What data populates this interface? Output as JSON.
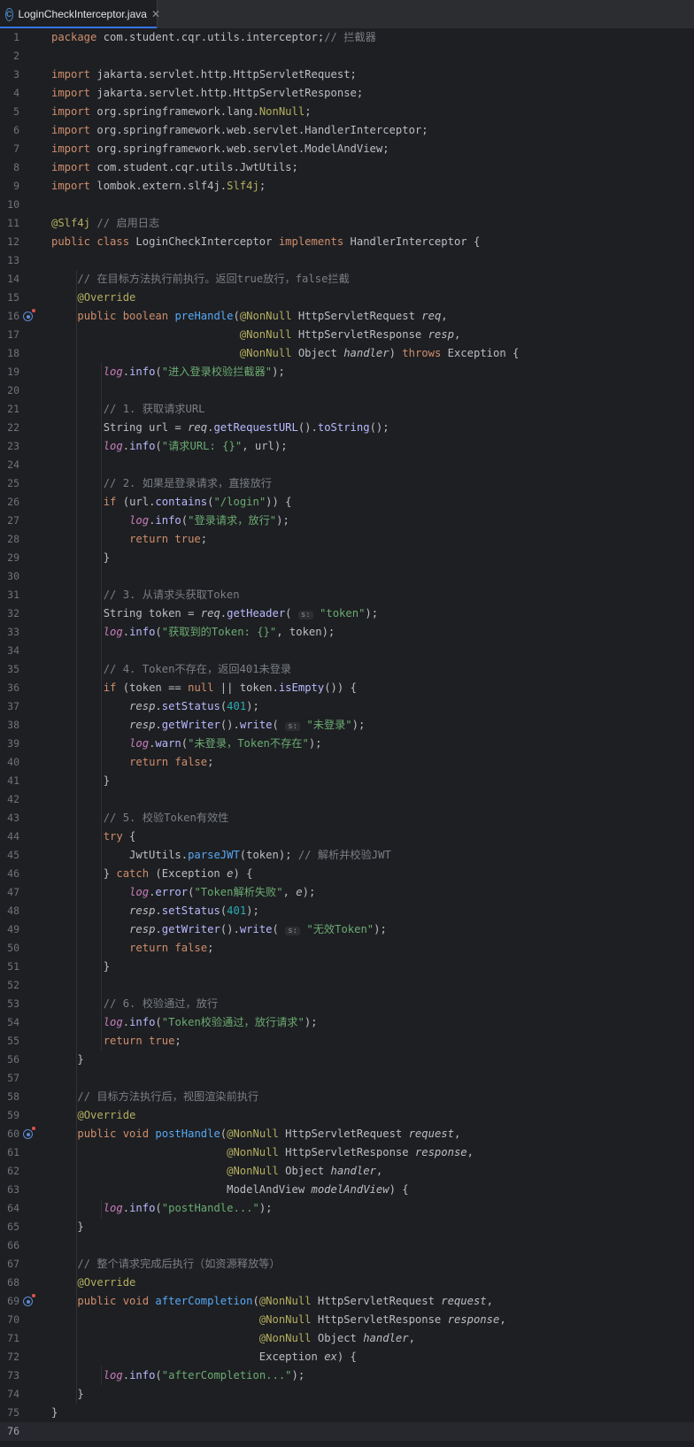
{
  "tab": {
    "filename": "LoginCheckInterceptor.java",
    "icon": "java-class-icon",
    "close_glyph": "✕"
  },
  "editor": {
    "current_line": 76,
    "gutter_icons": [
      {
        "line": 16,
        "icon": "override-method-icon"
      },
      {
        "line": 60,
        "icon": "override-method-icon"
      },
      {
        "line": 69,
        "icon": "override-method-icon"
      }
    ],
    "lines": [
      [
        [
          "kw",
          "package"
        ],
        [
          "t",
          " com.student.cqr.utils.interceptor;"
        ],
        [
          "cmt",
          "// 拦截器"
        ]
      ],
      [],
      [
        [
          "kw",
          "import"
        ],
        [
          "t",
          " jakarta.servlet.http.HttpServletRequest;"
        ]
      ],
      [
        [
          "kw",
          "import"
        ],
        [
          "t",
          " jakarta.servlet.http.HttpServletResponse;"
        ]
      ],
      [
        [
          "kw",
          "import"
        ],
        [
          "t",
          " org.springframework.lang."
        ],
        [
          "ann",
          "NonNull"
        ],
        [
          "t",
          ";"
        ]
      ],
      [
        [
          "kw",
          "import"
        ],
        [
          "t",
          " org.springframework.web.servlet.HandlerInterceptor;"
        ]
      ],
      [
        [
          "kw",
          "import"
        ],
        [
          "t",
          " org.springframework.web.servlet.ModelAndView;"
        ]
      ],
      [
        [
          "kw",
          "import"
        ],
        [
          "t",
          " com.student.cqr.utils.JwtUtils;"
        ]
      ],
      [
        [
          "kw",
          "import"
        ],
        [
          "t",
          " lombok.extern.slf4j."
        ],
        [
          "ann",
          "Slf4j"
        ],
        [
          "t",
          ";"
        ]
      ],
      [],
      [
        [
          "ann",
          "@Slf4j"
        ],
        [
          "cmt",
          " // 启用日志"
        ]
      ],
      [
        [
          "kw",
          "public class"
        ],
        [
          "t",
          " LoginCheckInterceptor "
        ],
        [
          "kw",
          "implements"
        ],
        [
          "t",
          " HandlerInterceptor {"
        ]
      ],
      [],
      [
        [
          "t",
          "    "
        ],
        [
          "cmt",
          "// 在目标方法执行前执行。返回true放行，false拦截"
        ]
      ],
      [
        [
          "t",
          "    "
        ],
        [
          "ann",
          "@Override"
        ]
      ],
      [
        [
          "t",
          "    "
        ],
        [
          "kw",
          "public boolean"
        ],
        [
          "t",
          " "
        ],
        [
          "fn",
          "preHandle"
        ],
        [
          "t",
          "("
        ],
        [
          "ann",
          "@NonNull"
        ],
        [
          "t",
          " HttpServletRequest "
        ],
        [
          "par",
          "req"
        ],
        [
          "t",
          ","
        ]
      ],
      [
        [
          "t",
          "                             "
        ],
        [
          "ann",
          "@NonNull"
        ],
        [
          "t",
          " HttpServletResponse "
        ],
        [
          "par",
          "resp"
        ],
        [
          "t",
          ","
        ]
      ],
      [
        [
          "t",
          "                             "
        ],
        [
          "ann",
          "@NonNull"
        ],
        [
          "t",
          " Object "
        ],
        [
          "par",
          "handler"
        ],
        [
          "t",
          ") "
        ],
        [
          "kw",
          "throws"
        ],
        [
          "t",
          " Exception {"
        ]
      ],
      [
        [
          "t",
          "        "
        ],
        [
          "stat",
          "log"
        ],
        [
          "t",
          "."
        ],
        [
          "meth",
          "info"
        ],
        [
          "t",
          "("
        ],
        [
          "str",
          "\"进入登录校验拦截器\""
        ],
        [
          "t",
          ");"
        ]
      ],
      [],
      [
        [
          "t",
          "        "
        ],
        [
          "cmt",
          "// 1. 获取请求URL"
        ]
      ],
      [
        [
          "t",
          "        String url = "
        ],
        [
          "par",
          "req"
        ],
        [
          "t",
          "."
        ],
        [
          "meth",
          "getRequestURL"
        ],
        [
          "t",
          "()."
        ],
        [
          "meth",
          "toString"
        ],
        [
          "t",
          "();"
        ]
      ],
      [
        [
          "t",
          "        "
        ],
        [
          "stat",
          "log"
        ],
        [
          "t",
          "."
        ],
        [
          "meth",
          "info"
        ],
        [
          "t",
          "("
        ],
        [
          "str",
          "\"请求URL: {}\""
        ],
        [
          "t",
          ", url);"
        ]
      ],
      [],
      [
        [
          "t",
          "        "
        ],
        [
          "cmt",
          "// 2. 如果是登录请求，直接放行"
        ]
      ],
      [
        [
          "t",
          "        "
        ],
        [
          "kw",
          "if"
        ],
        [
          "t",
          " (url."
        ],
        [
          "meth",
          "contains"
        ],
        [
          "t",
          "("
        ],
        [
          "str",
          "\"/login\""
        ],
        [
          "t",
          ")) {"
        ]
      ],
      [
        [
          "t",
          "            "
        ],
        [
          "stat",
          "log"
        ],
        [
          "t",
          "."
        ],
        [
          "meth",
          "info"
        ],
        [
          "t",
          "("
        ],
        [
          "str",
          "\"登录请求，放行\""
        ],
        [
          "t",
          ");"
        ]
      ],
      [
        [
          "t",
          "            "
        ],
        [
          "kw",
          "return true"
        ],
        [
          "t",
          ";"
        ]
      ],
      [
        [
          "t",
          "        }"
        ]
      ],
      [],
      [
        [
          "t",
          "        "
        ],
        [
          "cmt",
          "// 3. 从请求头获取Token"
        ]
      ],
      [
        [
          "t",
          "        String token = "
        ],
        [
          "par",
          "req"
        ],
        [
          "t",
          "."
        ],
        [
          "meth",
          "getHeader"
        ],
        [
          "t",
          "( "
        ],
        [
          "hint",
          "s:"
        ],
        [
          "t",
          " "
        ],
        [
          "str",
          "\"token\""
        ],
        [
          "t",
          ");"
        ]
      ],
      [
        [
          "t",
          "        "
        ],
        [
          "stat",
          "log"
        ],
        [
          "t",
          "."
        ],
        [
          "meth",
          "info"
        ],
        [
          "t",
          "("
        ],
        [
          "str",
          "\"获取到的Token: {}\""
        ],
        [
          "t",
          ", token);"
        ]
      ],
      [],
      [
        [
          "t",
          "        "
        ],
        [
          "cmt",
          "// 4. Token不存在，返回401未登录"
        ]
      ],
      [
        [
          "t",
          "        "
        ],
        [
          "kw",
          "if"
        ],
        [
          "t",
          " (token == "
        ],
        [
          "kw",
          "null"
        ],
        [
          "t",
          " || token."
        ],
        [
          "meth",
          "isEmpty"
        ],
        [
          "t",
          "()) {"
        ]
      ],
      [
        [
          "t",
          "            "
        ],
        [
          "par",
          "resp"
        ],
        [
          "t",
          "."
        ],
        [
          "meth",
          "setStatus"
        ],
        [
          "t",
          "("
        ],
        [
          "num",
          "401"
        ],
        [
          "t",
          ");"
        ]
      ],
      [
        [
          "t",
          "            "
        ],
        [
          "par",
          "resp"
        ],
        [
          "t",
          "."
        ],
        [
          "meth",
          "getWriter"
        ],
        [
          "t",
          "()."
        ],
        [
          "meth",
          "write"
        ],
        [
          "t",
          "( "
        ],
        [
          "hint",
          "s:"
        ],
        [
          "t",
          " "
        ],
        [
          "str",
          "\"未登录\""
        ],
        [
          "t",
          ");"
        ]
      ],
      [
        [
          "t",
          "            "
        ],
        [
          "stat",
          "log"
        ],
        [
          "t",
          "."
        ],
        [
          "meth",
          "warn"
        ],
        [
          "t",
          "("
        ],
        [
          "str",
          "\"未登录，Token不存在\""
        ],
        [
          "t",
          ");"
        ]
      ],
      [
        [
          "t",
          "            "
        ],
        [
          "kw",
          "return false"
        ],
        [
          "t",
          ";"
        ]
      ],
      [
        [
          "t",
          "        }"
        ]
      ],
      [],
      [
        [
          "t",
          "        "
        ],
        [
          "cmt",
          "// 5. 校验Token有效性"
        ]
      ],
      [
        [
          "t",
          "        "
        ],
        [
          "kw",
          "try"
        ],
        [
          "t",
          " {"
        ]
      ],
      [
        [
          "t",
          "            JwtUtils."
        ],
        [
          "fn",
          "parseJWT"
        ],
        [
          "t",
          "(token); "
        ],
        [
          "cmt",
          "// 解析并校验JWT"
        ]
      ],
      [
        [
          "t",
          "        } "
        ],
        [
          "kw",
          "catch"
        ],
        [
          "t",
          " (Exception "
        ],
        [
          "par",
          "e"
        ],
        [
          "t",
          ") {"
        ]
      ],
      [
        [
          "t",
          "            "
        ],
        [
          "stat",
          "log"
        ],
        [
          "t",
          "."
        ],
        [
          "meth",
          "error"
        ],
        [
          "t",
          "("
        ],
        [
          "str",
          "\"Token解析失败\""
        ],
        [
          "t",
          ", "
        ],
        [
          "par",
          "e"
        ],
        [
          "t",
          ");"
        ]
      ],
      [
        [
          "t",
          "            "
        ],
        [
          "par",
          "resp"
        ],
        [
          "t",
          "."
        ],
        [
          "meth",
          "setStatus"
        ],
        [
          "t",
          "("
        ],
        [
          "num",
          "401"
        ],
        [
          "t",
          ");"
        ]
      ],
      [
        [
          "t",
          "            "
        ],
        [
          "par",
          "resp"
        ],
        [
          "t",
          "."
        ],
        [
          "meth",
          "getWriter"
        ],
        [
          "t",
          "()."
        ],
        [
          "meth",
          "write"
        ],
        [
          "t",
          "( "
        ],
        [
          "hint",
          "s:"
        ],
        [
          "t",
          " "
        ],
        [
          "str",
          "\"无效Token\""
        ],
        [
          "t",
          ");"
        ]
      ],
      [
        [
          "t",
          "            "
        ],
        [
          "kw",
          "return false"
        ],
        [
          "t",
          ";"
        ]
      ],
      [
        [
          "t",
          "        }"
        ]
      ],
      [],
      [
        [
          "t",
          "        "
        ],
        [
          "cmt",
          "// 6. 校验通过，放行"
        ]
      ],
      [
        [
          "t",
          "        "
        ],
        [
          "stat",
          "log"
        ],
        [
          "t",
          "."
        ],
        [
          "meth",
          "info"
        ],
        [
          "t",
          "("
        ],
        [
          "str",
          "\"Token校验通过，放行请求\""
        ],
        [
          "t",
          ");"
        ]
      ],
      [
        [
          "t",
          "        "
        ],
        [
          "kw",
          "return true"
        ],
        [
          "t",
          ";"
        ]
      ],
      [
        [
          "t",
          "    }"
        ]
      ],
      [],
      [
        [
          "t",
          "    "
        ],
        [
          "cmt",
          "// 目标方法执行后，视图渲染前执行"
        ]
      ],
      [
        [
          "t",
          "    "
        ],
        [
          "ann",
          "@Override"
        ]
      ],
      [
        [
          "t",
          "    "
        ],
        [
          "kw",
          "public void"
        ],
        [
          "t",
          " "
        ],
        [
          "fn",
          "postHandle"
        ],
        [
          "t",
          "("
        ],
        [
          "ann",
          "@NonNull"
        ],
        [
          "t",
          " HttpServletRequest "
        ],
        [
          "par",
          "request"
        ],
        [
          "t",
          ","
        ]
      ],
      [
        [
          "t",
          "                           "
        ],
        [
          "ann",
          "@NonNull"
        ],
        [
          "t",
          " HttpServletResponse "
        ],
        [
          "par",
          "response"
        ],
        [
          "t",
          ","
        ]
      ],
      [
        [
          "t",
          "                           "
        ],
        [
          "ann",
          "@NonNull"
        ],
        [
          "t",
          " Object "
        ],
        [
          "par",
          "handler"
        ],
        [
          "t",
          ","
        ]
      ],
      [
        [
          "t",
          "                           ModelAndView "
        ],
        [
          "par",
          "modelAndView"
        ],
        [
          "t",
          ") {"
        ]
      ],
      [
        [
          "t",
          "        "
        ],
        [
          "stat",
          "log"
        ],
        [
          "t",
          "."
        ],
        [
          "meth",
          "info"
        ],
        [
          "t",
          "("
        ],
        [
          "str",
          "\"postHandle...\""
        ],
        [
          "t",
          ");"
        ]
      ],
      [
        [
          "t",
          "    }"
        ]
      ],
      [],
      [
        [
          "t",
          "    "
        ],
        [
          "cmt",
          "// 整个请求完成后执行（如资源释放等）"
        ]
      ],
      [
        [
          "t",
          "    "
        ],
        [
          "ann",
          "@Override"
        ]
      ],
      [
        [
          "t",
          "    "
        ],
        [
          "kw",
          "public void"
        ],
        [
          "t",
          " "
        ],
        [
          "fn",
          "afterCompletion"
        ],
        [
          "t",
          "("
        ],
        [
          "ann",
          "@NonNull"
        ],
        [
          "t",
          " HttpServletRequest "
        ],
        [
          "par",
          "request"
        ],
        [
          "t",
          ","
        ]
      ],
      [
        [
          "t",
          "                                "
        ],
        [
          "ann",
          "@NonNull"
        ],
        [
          "t",
          " HttpServletResponse "
        ],
        [
          "par",
          "response"
        ],
        [
          "t",
          ","
        ]
      ],
      [
        [
          "t",
          "                                "
        ],
        [
          "ann",
          "@NonNull"
        ],
        [
          "t",
          " Object "
        ],
        [
          "par",
          "handler"
        ],
        [
          "t",
          ","
        ]
      ],
      [
        [
          "t",
          "                                Exception "
        ],
        [
          "par",
          "ex"
        ],
        [
          "t",
          ") {"
        ]
      ],
      [
        [
          "t",
          "        "
        ],
        [
          "stat",
          "log"
        ],
        [
          "t",
          "."
        ],
        [
          "meth",
          "info"
        ],
        [
          "t",
          "("
        ],
        [
          "str",
          "\"afterCompletion...\""
        ],
        [
          "t",
          ");"
        ]
      ],
      [
        [
          "t",
          "    }"
        ]
      ],
      [
        [
          "t",
          "}"
        ]
      ],
      []
    ]
  }
}
